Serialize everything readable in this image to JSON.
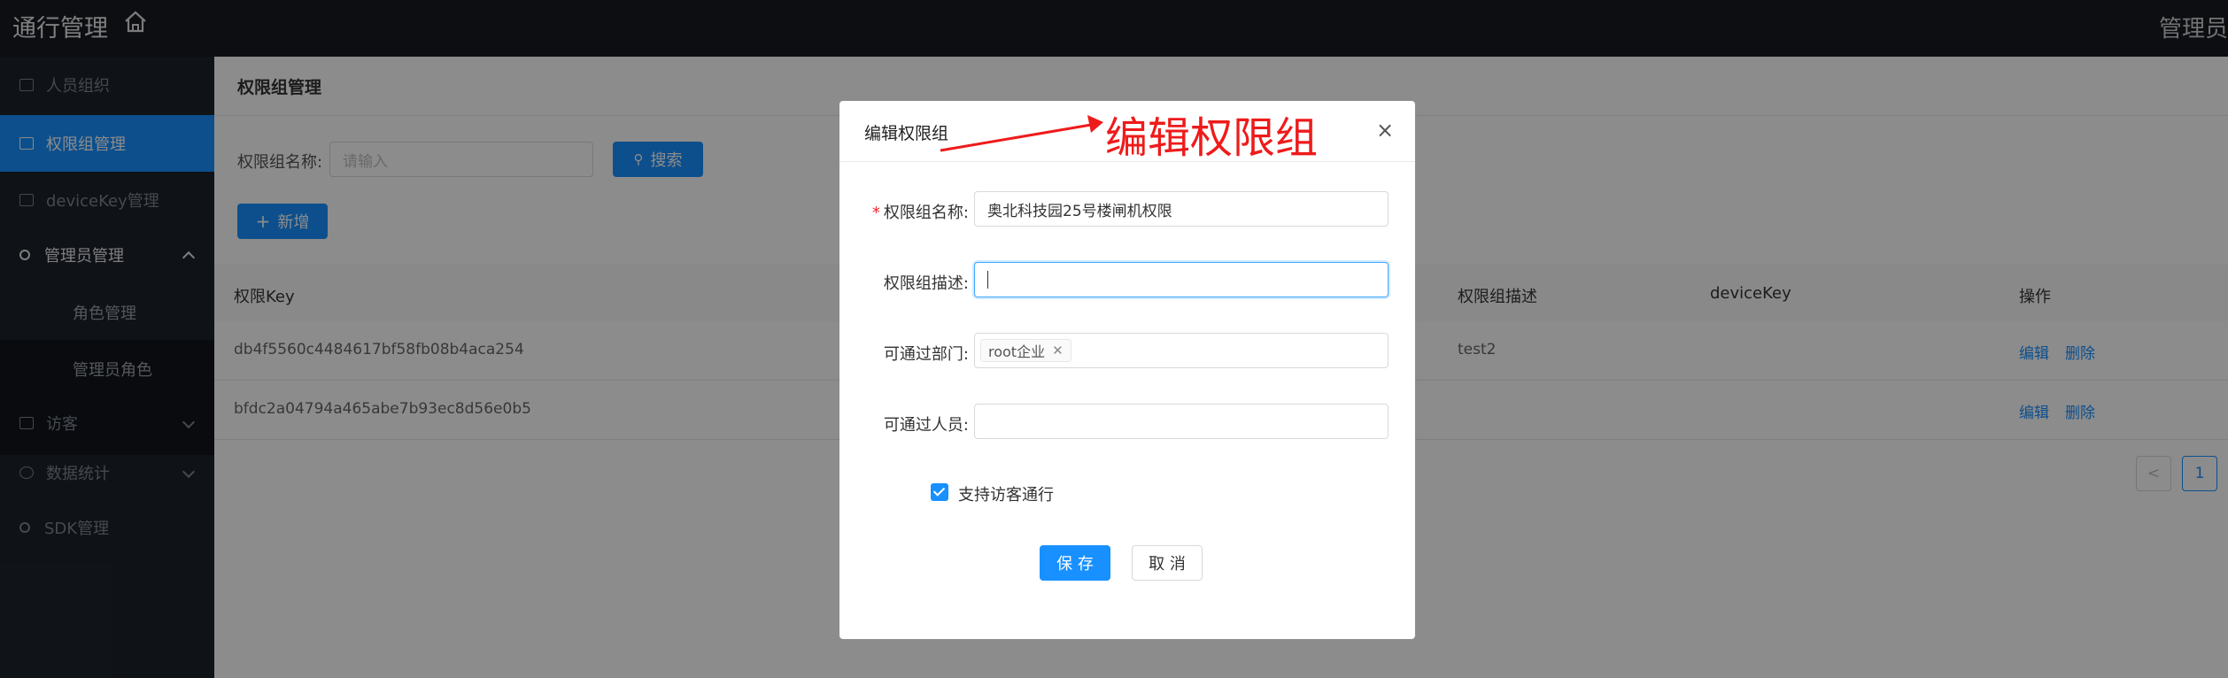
{
  "app": {
    "title": "通行管理",
    "user_label": "管理员",
    "home_icon": "home-icon"
  },
  "sidebar": {
    "items": [
      {
        "label": "人员组织",
        "icon": "org-icon"
      },
      {
        "label": "权限组管理",
        "icon": "group-icon",
        "active": true
      },
      {
        "label": "deviceKey管理",
        "icon": "device-icon"
      },
      {
        "label": "管理员管理",
        "icon": "search-icon"
      },
      {
        "label": "访客",
        "icon": "visitor-icon"
      },
      {
        "label": "数据统计",
        "icon": "chart-icon"
      },
      {
        "label": "SDK管理",
        "icon": "search-icon"
      }
    ],
    "sub_items": [
      {
        "label": "角色管理"
      },
      {
        "label": "管理员角色"
      }
    ]
  },
  "page": {
    "title": "权限组管理",
    "search": {
      "label": "权限组名称:",
      "placeholder": "请输入",
      "button_label": "搜索"
    },
    "add_button_label": "新增"
  },
  "table": {
    "columns": [
      "权限Key",
      "权限组描述",
      "deviceKey",
      "操作"
    ],
    "rows": [
      {
        "key": "db4f5560c4484617bf58fb08b4aca254",
        "description": "test2",
        "deviceKey": "",
        "actions": [
          "编辑",
          "删除"
        ]
      },
      {
        "key": "bfdc2a04794a465abe7b93ec8d56e0b5",
        "description": "",
        "deviceKey": "",
        "actions": [
          "编辑",
          "删除"
        ]
      }
    ]
  },
  "pagination": {
    "prev": "<",
    "current": "1"
  },
  "modal": {
    "title": "编辑权限组",
    "annotation": "编辑权限组",
    "fields": {
      "name": {
        "label": "权限组名称:",
        "value": "奥北科技园25号楼闸机权限",
        "required": true
      },
      "description": {
        "label": "权限组描述:",
        "value": ""
      },
      "departments": {
        "label": "可通过部门:",
        "tags": [
          "root企业"
        ]
      },
      "persons": {
        "label": "可通过人员:",
        "value": ""
      }
    },
    "checkbox": {
      "label": "支持访客通行",
      "checked": true
    },
    "save_label": "保 存",
    "cancel_label": "取 消"
  },
  "colors": {
    "primary": "#1890ff",
    "sidebar_bg": "#1d222b",
    "topbar_bg": "#161b22",
    "annotation": "#ee1b1b"
  }
}
